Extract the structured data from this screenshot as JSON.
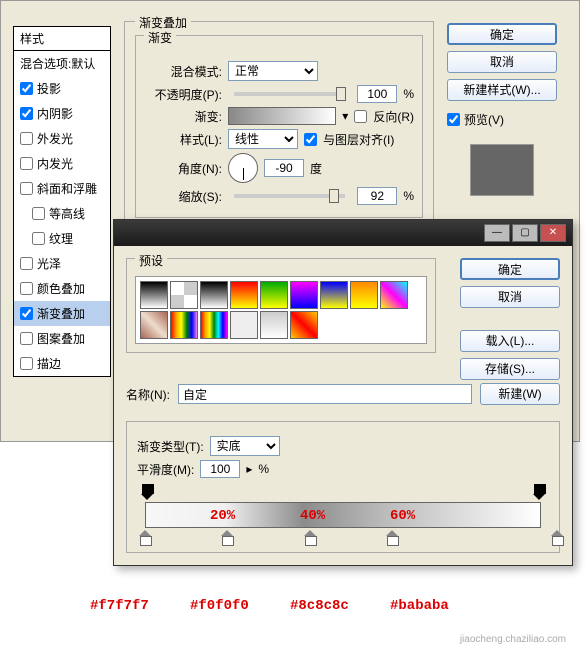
{
  "layerStyle": {
    "stylesHeader": "样式",
    "blendingOptions": "混合选项:默认",
    "items": [
      {
        "label": "投影",
        "checked": true
      },
      {
        "label": "内阴影",
        "checked": true
      },
      {
        "label": "外发光",
        "checked": false
      },
      {
        "label": "内发光",
        "checked": false
      },
      {
        "label": "斜面和浮雕",
        "checked": false
      },
      {
        "label": "等高线",
        "checked": false,
        "sub": true
      },
      {
        "label": "纹理",
        "checked": false,
        "sub": true
      },
      {
        "label": "光泽",
        "checked": false
      },
      {
        "label": "颜色叠加",
        "checked": false
      },
      {
        "label": "渐变叠加",
        "checked": true,
        "selected": true
      },
      {
        "label": "图案叠加",
        "checked": false
      },
      {
        "label": "描边",
        "checked": false
      }
    ]
  },
  "panel": {
    "title": "渐变叠加",
    "groupTitle": "渐变",
    "blendMode": {
      "label": "混合模式:",
      "value": "正常"
    },
    "opacity": {
      "label": "不透明度(P):",
      "value": "100",
      "unit": "%"
    },
    "gradient": {
      "label": "渐变:",
      "reverse": "反向(R)"
    },
    "style": {
      "label": "样式(L):",
      "value": "线性",
      "align": "与图层对齐(I)"
    },
    "angle": {
      "label": "角度(N):",
      "value": "-90",
      "unit": "度"
    },
    "scale": {
      "label": "缩放(S):",
      "value": "92",
      "unit": "%"
    }
  },
  "buttons": {
    "ok": "确定",
    "cancel": "取消",
    "newStyle": "新建样式(W)...",
    "preview": "预览(V)"
  },
  "gradEditor": {
    "presets": "预设",
    "ok": "确定",
    "cancel": "取消",
    "load": "载入(L)...",
    "save": "存储(S)...",
    "new": "新建(W)",
    "nameLabel": "名称(N):",
    "nameValue": "自定",
    "typeLabel": "渐变类型(T):",
    "typeValue": "实底",
    "smoothLabel": "平滑度(M):",
    "smoothValue": "100",
    "smoothUnit": "%",
    "stops": [
      {
        "pos": 0,
        "color": "#f7f7f7"
      },
      {
        "pos": 20,
        "color": "#f0f0f0"
      },
      {
        "pos": 40,
        "color": "#8c8c8c"
      },
      {
        "pos": 60,
        "color": "#bababa"
      },
      {
        "pos": 100,
        "color": "#ffffff"
      }
    ],
    "thumbs": [
      "linear-gradient(#000,#fff)",
      "repeating-conic-gradient(#ccc 0 25%,#fff 0 50%)",
      "linear-gradient(#000,#fff)",
      "linear-gradient(red,yellow)",
      "linear-gradient(#0a0,#ff0)",
      "linear-gradient(#f0f,#00f)",
      "linear-gradient(#00f,#ff0)",
      "linear-gradient(#f80,#ff0)",
      "linear-gradient(45deg,#ff0,#f0f,#0ff)",
      "linear-gradient(45deg,#a65,#edc,#a65)",
      "linear-gradient(90deg,red,orange,yellow,green,blue,violet)",
      "linear-gradient(90deg,red,orange,yellow,green,cyan,blue,magenta)",
      "#eee",
      "linear-gradient(#ccc,#fff)",
      "linear-gradient(45deg,#fc0,#f00,#fc0)"
    ]
  },
  "annotations": {
    "p20": "20%",
    "p40": "40%",
    "p60": "60%",
    "c1": "#f7f7f7",
    "c2": "#f0f0f0",
    "c3": "#8c8c8c",
    "c4": "#bababa"
  },
  "watermark": "jiaocheng.chaziliao.com"
}
